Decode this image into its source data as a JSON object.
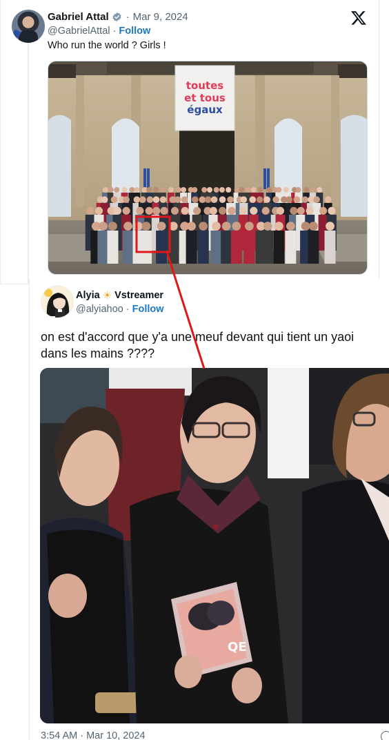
{
  "tweet1": {
    "display_name": "Gabriel Attal",
    "date": "Mar 9, 2024",
    "handle": "@GabrielAttal",
    "follow_label": "Follow",
    "text": "Who run the world ? Girls !",
    "banner_lines": [
      "toutes",
      "et tous",
      "égaux"
    ],
    "icons": {
      "verified": "verified-badge-icon",
      "platform": "x-logo-icon"
    }
  },
  "tweet2": {
    "display_name": "Alyia",
    "display_name_suffix": "Vstreamer",
    "handle": "@alyiahoo",
    "follow_label": "Follow",
    "text_lines": [
      "on est d'accord que y'a une meuf devant qui tient un yaoi",
      "dans les mains ????"
    ],
    "timestamp": "3:54 AM · Mar 10, 2024",
    "book_title": "QE"
  },
  "colors": {
    "follow": "#1d78c1",
    "secondary_text": "#536471",
    "annotation": "#e0161b",
    "verified": "#829aab"
  }
}
